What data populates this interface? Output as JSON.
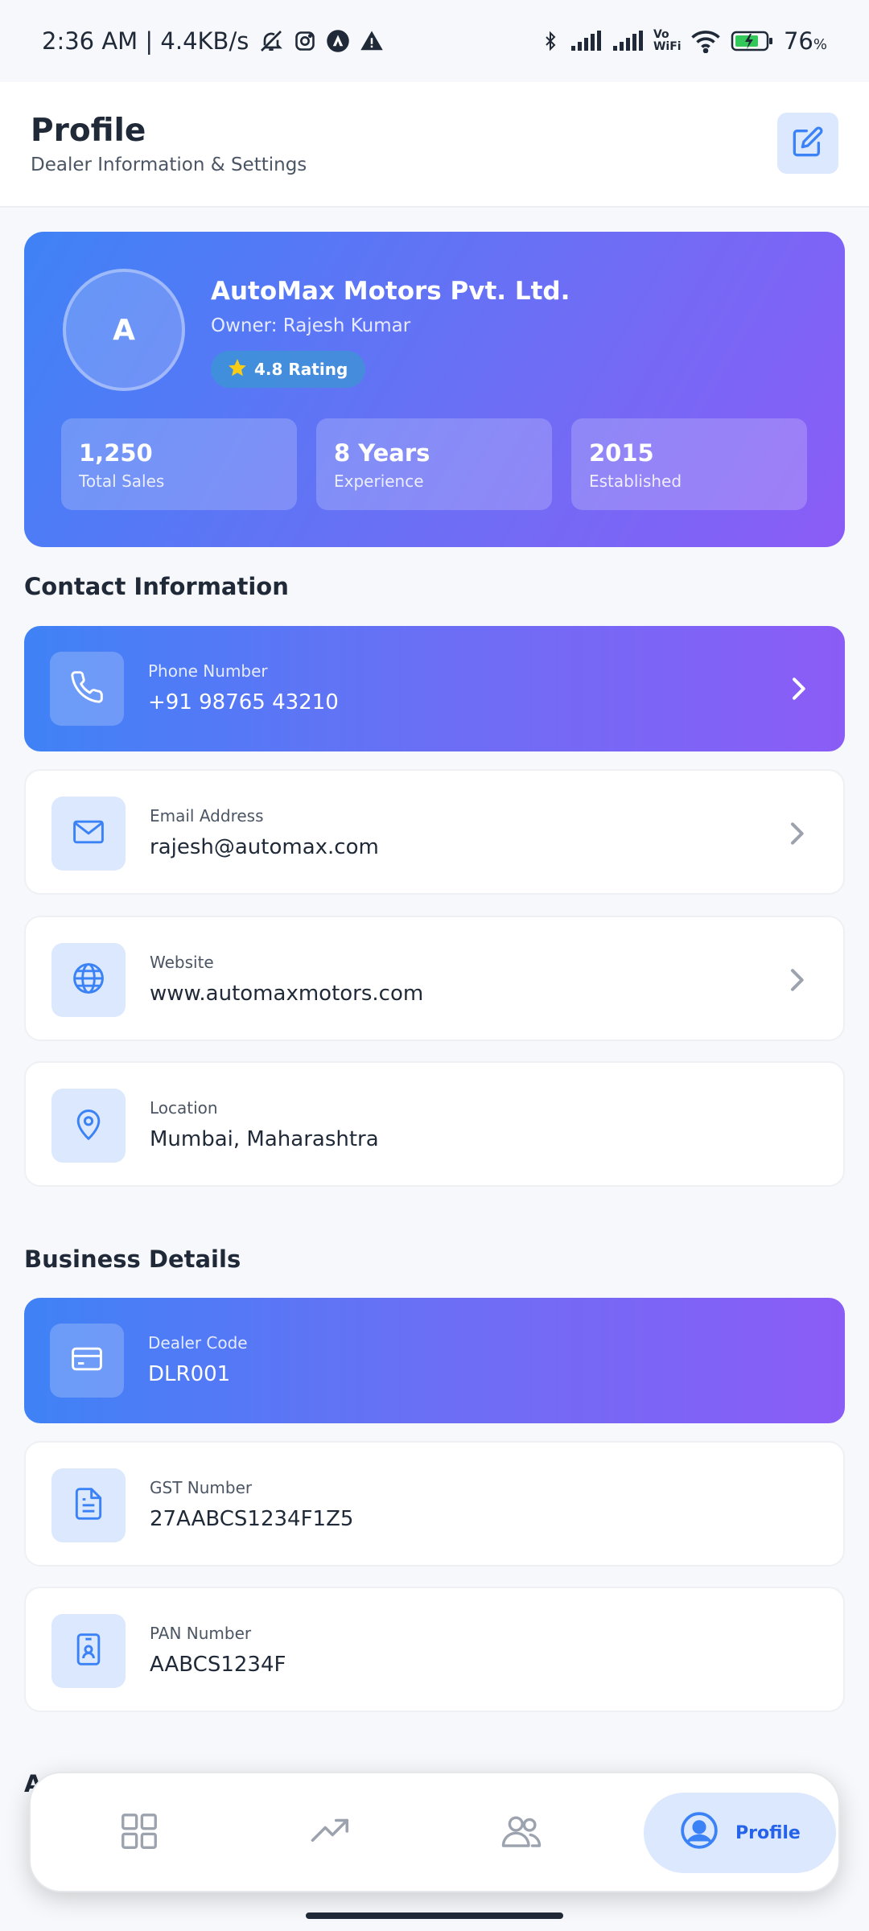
{
  "status_bar": {
    "time_network": "2:36 AM | 4.4KB/s",
    "vowifi": "Vo WiFi",
    "battery": "76"
  },
  "header": {
    "title": "Profile",
    "subtitle": "Dealer Information & Settings"
  },
  "dealer": {
    "initial": "A",
    "name": "AutoMax Motors Pvt. Ltd.",
    "owner": "Owner: Rajesh Kumar",
    "rating": "4.8 Rating",
    "stats": [
      {
        "value": "1,250",
        "label": "Total Sales"
      },
      {
        "value": "8 Years",
        "label": "Experience"
      },
      {
        "value": "2015",
        "label": "Established"
      }
    ]
  },
  "contact": {
    "title": "Contact Information",
    "items": [
      {
        "label": "Phone Number",
        "value": "+91 98765 43210",
        "icon": "phone-icon"
      },
      {
        "label": "Email Address",
        "value": "rajesh@automax.com",
        "icon": "mail-icon"
      },
      {
        "label": "Website",
        "value": "www.automaxmotors.com",
        "icon": "globe-icon"
      },
      {
        "label": "Location",
        "value": "Mumbai, Maharashtra",
        "icon": "location-pin-icon"
      }
    ]
  },
  "business": {
    "title": "Business Details",
    "items": [
      {
        "label": "Dealer Code",
        "value": "DLR001",
        "icon": "credit-card-icon"
      },
      {
        "label": "GST Number",
        "value": "27AABCS1234F1Z5",
        "icon": "document-icon"
      },
      {
        "label": "PAN Number",
        "value": "AABCS1234F",
        "icon": "id-card-icon"
      }
    ]
  },
  "partial_section_title": "A",
  "bottom_nav": {
    "items": [
      {
        "name": "dashboard",
        "icon": "grid-icon"
      },
      {
        "name": "analytics",
        "icon": "trend-up-icon"
      },
      {
        "name": "customers",
        "icon": "users-icon"
      },
      {
        "name": "profile",
        "icon": "user-circle-icon",
        "label": "Profile",
        "active": true
      }
    ]
  },
  "colors": {
    "gradient_start": "#3f82f6",
    "gradient_end": "#8b5cf6",
    "icon_bg": "#dbe8fe",
    "accent": "#3b82f6",
    "star": "#facc15"
  }
}
